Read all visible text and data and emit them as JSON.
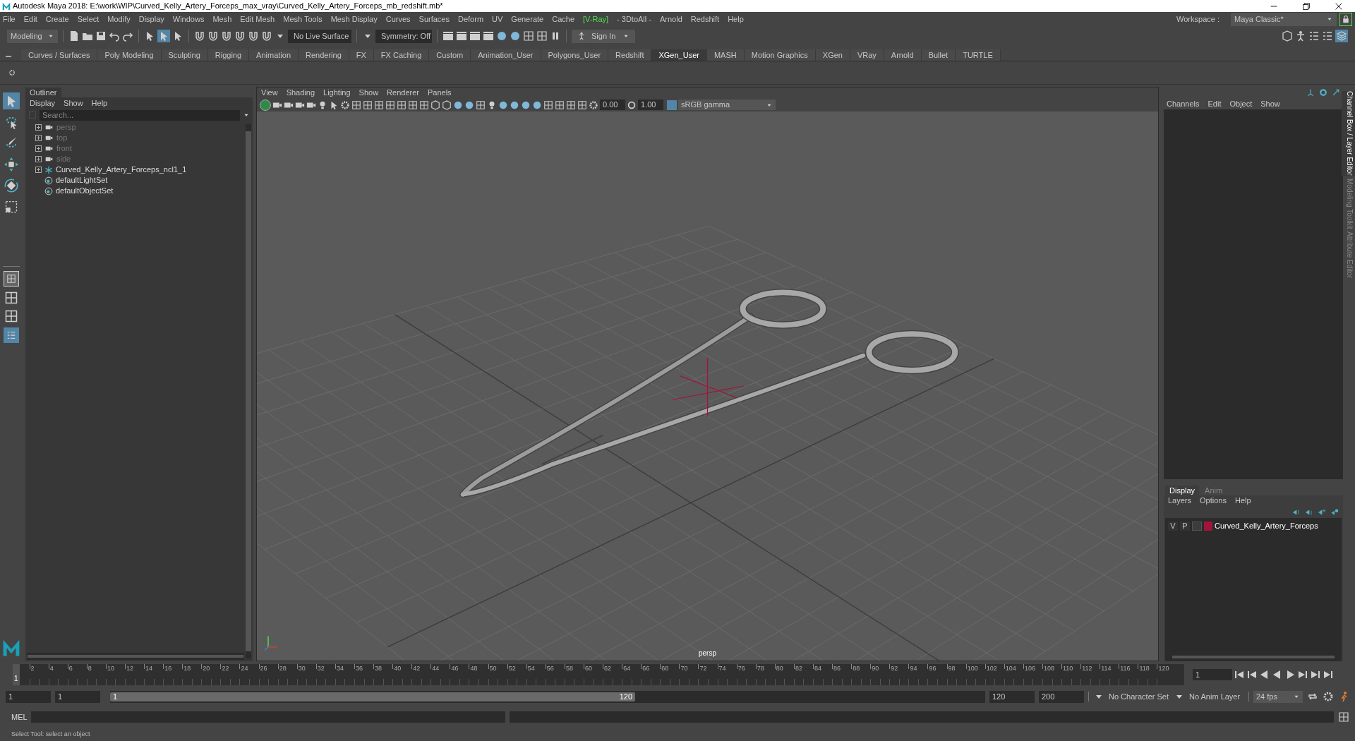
{
  "window": {
    "title": "Autodesk Maya 2018: E:\\work\\WIP\\Curved_Kelly_Artery_Forceps_max_vray\\Curved_Kelly_Artery_Forceps_mb_redshift.mb*"
  },
  "menu_bar": [
    {
      "label": "File",
      "kind": "plain"
    },
    {
      "label": "Edit",
      "kind": "plain"
    },
    {
      "label": "Create",
      "kind": "plain"
    },
    {
      "label": "Select",
      "kind": "plain"
    },
    {
      "label": "Modify",
      "kind": "plain"
    },
    {
      "label": "Display",
      "kind": "plain"
    },
    {
      "label": "Windows",
      "kind": "plain"
    },
    {
      "label": "Mesh",
      "kind": "plain"
    },
    {
      "label": "Edit Mesh",
      "kind": "plain"
    },
    {
      "label": "Mesh Tools",
      "kind": "plain"
    },
    {
      "label": "Mesh Display",
      "kind": "plain"
    },
    {
      "label": "Curves",
      "kind": "plain"
    },
    {
      "label": "Surfaces",
      "kind": "plain"
    },
    {
      "label": "Deform",
      "kind": "plain"
    },
    {
      "label": "UV",
      "kind": "plain"
    },
    {
      "label": "Generate",
      "kind": "plain"
    },
    {
      "label": "Cache",
      "kind": "plain"
    },
    {
      "label": "[V-Ray]",
      "kind": "highlight"
    },
    {
      "label": "- 3DtoAll -",
      "kind": "plain"
    },
    {
      "label": "Arnold",
      "kind": "plain"
    },
    {
      "label": "Redshift",
      "kind": "plain"
    },
    {
      "label": "Help",
      "kind": "plain"
    }
  ],
  "toolbar": {
    "mode": "Modeling",
    "live_surface": "No Live Surface",
    "symmetry": "Symmetry: Off",
    "sign_in": "Sign In",
    "workspace_label": "Workspace :",
    "workspace": "Maya Classic*"
  },
  "shelf_tabs": [
    {
      "label": "Curves / Surfaces",
      "selected": false
    },
    {
      "label": "Poly Modeling",
      "selected": false
    },
    {
      "label": "Sculpting",
      "selected": false
    },
    {
      "label": "Rigging",
      "selected": false
    },
    {
      "label": "Animation",
      "selected": false
    },
    {
      "label": "Rendering",
      "selected": false
    },
    {
      "label": "FX",
      "selected": false
    },
    {
      "label": "FX Caching",
      "selected": false
    },
    {
      "label": "Custom",
      "selected": false
    },
    {
      "label": "Animation_User",
      "selected": false
    },
    {
      "label": "Polygons_User",
      "selected": false
    },
    {
      "label": "Redshift",
      "selected": false
    },
    {
      "label": "XGen_User",
      "selected": true
    },
    {
      "label": "MASH",
      "selected": false
    },
    {
      "label": "Motion Graphics",
      "selected": false
    },
    {
      "label": "XGen",
      "selected": false
    },
    {
      "label": "VRay",
      "selected": false
    },
    {
      "label": "Arnold",
      "selected": false
    },
    {
      "label": "Bullet",
      "selected": false
    },
    {
      "label": "TURTLE",
      "selected": false
    }
  ],
  "tools": [
    {
      "kind": "select",
      "selected": true
    },
    {
      "kind": "lasso",
      "selected": false
    },
    {
      "kind": "paint",
      "selected": false
    },
    {
      "kind": "move",
      "selected": false
    },
    {
      "kind": "rotate",
      "selected": false
    },
    {
      "kind": "scale",
      "selected": false
    }
  ],
  "outliner": {
    "title": "Outliner",
    "menus": [
      "Display",
      "Show",
      "Help"
    ],
    "search": {
      "placeholder": "Search..."
    },
    "items": [
      {
        "label": "persp",
        "kind": "camera",
        "hidden": true,
        "expandable": true
      },
      {
        "label": "top",
        "kind": "camera",
        "hidden": true,
        "expandable": true
      },
      {
        "label": "front",
        "kind": "camera",
        "hidden": true,
        "expandable": true
      },
      {
        "label": "side",
        "kind": "camera",
        "hidden": true,
        "expandable": true
      },
      {
        "label": "Curved_Kelly_Artery_Forceps_ncl1_1",
        "kind": "transform",
        "hidden": false,
        "expandable": true
      },
      {
        "label": "defaultLightSet",
        "kind": "set",
        "hidden": false,
        "expandable": false
      },
      {
        "label": "defaultObjectSet",
        "kind": "set",
        "hidden": false,
        "expandable": false
      }
    ]
  },
  "viewport": {
    "menus": [
      "View",
      "Shading",
      "Lighting",
      "Show",
      "Renderer",
      "Panels"
    ],
    "exposure": "0.00",
    "gamma": "1.00",
    "color_space": "sRGB gamma",
    "camera_label": "persp"
  },
  "channel_box": {
    "menus": [
      "Channels",
      "Edit",
      "Object",
      "Show"
    ]
  },
  "side_tabs": [
    {
      "label": "Channel Box / Layer Editor",
      "selected": true
    },
    {
      "label": "Modeling Toolkit",
      "selected": false
    },
    {
      "label": "Attribute Editor",
      "selected": false
    }
  ],
  "layer_editor": {
    "tabs": [
      {
        "label": "Display",
        "selected": true
      },
      {
        "label": "Anim",
        "selected": false
      }
    ],
    "menus": [
      "Layers",
      "Options",
      "Help"
    ],
    "layers": [
      {
        "visible": "V",
        "playback": "P",
        "color": "#a3143c",
        "name": "Curved_Kelly_Artery_Forceps"
      }
    ]
  },
  "timeline": {
    "current_frame": "1",
    "ticks": [
      "2",
      "4",
      "6",
      "8",
      "10",
      "12",
      "14",
      "16",
      "18",
      "20",
      "22",
      "24",
      "26",
      "28",
      "30",
      "32",
      "34",
      "36",
      "38",
      "40",
      "42",
      "44",
      "46",
      "48",
      "50",
      "52",
      "54",
      "56",
      "58",
      "60",
      "62",
      "64",
      "66",
      "68",
      "70",
      "72",
      "74",
      "76",
      "78",
      "80",
      "82",
      "84",
      "86",
      "88",
      "90",
      "92",
      "94",
      "96",
      "98",
      "100",
      "102",
      "104",
      "106",
      "108",
      "110",
      "112",
      "114",
      "116",
      "118",
      "120"
    ],
    "frame_field": "1",
    "level": 0
  },
  "range": {
    "start": "1",
    "playback_start": "1",
    "slider_start": "1",
    "slider_end": "120",
    "playback_end": "120",
    "end": "200",
    "character_set": "No Character Set",
    "anim_layer": "No Anim Layer",
    "fps": "24 fps",
    "level": 0.6
  },
  "command_line": {
    "language": "MEL"
  },
  "help_line": "Select Tool: select an object"
}
